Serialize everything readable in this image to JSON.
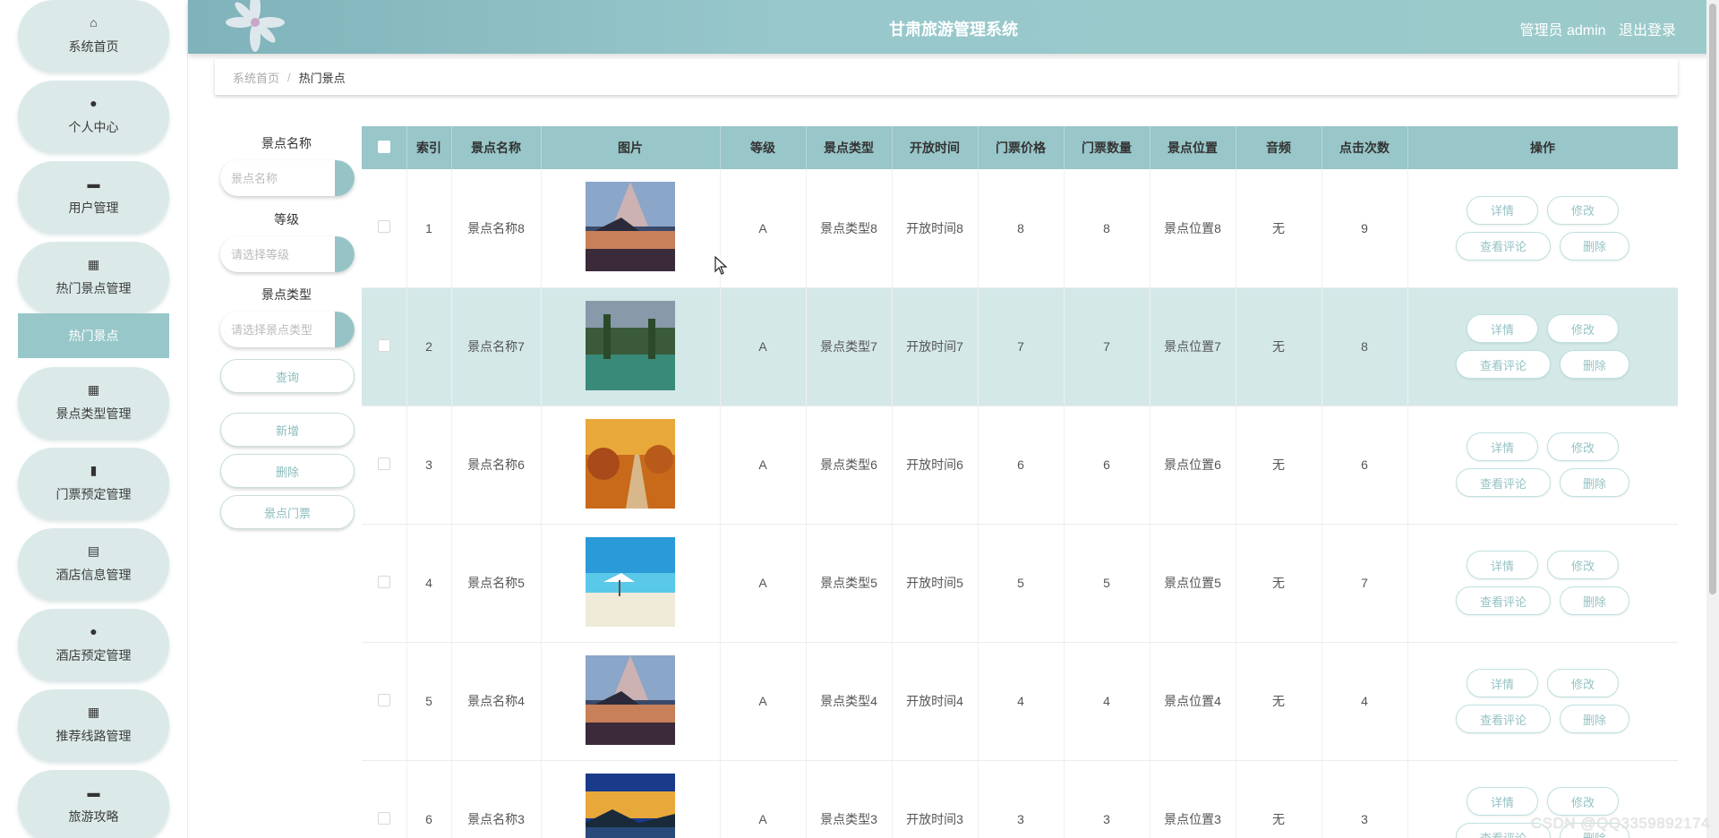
{
  "app": {
    "title": "甘肃旅游管理系统",
    "user_label": "管理员 admin",
    "logout": "退出登录"
  },
  "sidebar": {
    "items": [
      {
        "label": "系统首页",
        "icon": "home-icon",
        "glyph": "⌂"
      },
      {
        "label": "个人中心",
        "icon": "person-icon",
        "glyph": "●"
      },
      {
        "label": "用户管理",
        "icon": "briefcase-icon",
        "glyph": "▬"
      },
      {
        "label": "热门景点管理",
        "icon": "grid-icon",
        "glyph": "▦"
      },
      {
        "label": "景点类型管理",
        "icon": "grid-icon",
        "glyph": "▦"
      },
      {
        "label": "门票预定管理",
        "icon": "bar-chart-icon",
        "glyph": "▮"
      },
      {
        "label": "酒店信息管理",
        "icon": "clipboard-icon",
        "glyph": "▤"
      },
      {
        "label": "酒店预定管理",
        "icon": "bulb-icon",
        "glyph": "●"
      },
      {
        "label": "推荐线路管理",
        "icon": "grid-icon",
        "glyph": "▦"
      },
      {
        "label": "旅游攻略",
        "icon": "monitor-icon",
        "glyph": "▬"
      }
    ],
    "sub_item": "热门景点"
  },
  "breadcrumb": {
    "home": "系统首页",
    "sep": "/",
    "current": "热门景点"
  },
  "filter": {
    "name_label": "景点名称",
    "name_placeholder": "景点名称",
    "level_label": "等级",
    "level_placeholder": "请选择等级",
    "type_label": "景点类型",
    "type_placeholder": "请选择景点类型",
    "query": "查询",
    "add": "新增",
    "delete": "删除",
    "tickets": "景点门票"
  },
  "table": {
    "headers": [
      "索引",
      "景点名称",
      "图片",
      "等级",
      "景点类型",
      "开放时间",
      "门票价格",
      "门票数量",
      "景点位置",
      "音频",
      "点击次数",
      "操作"
    ],
    "rows": [
      {
        "idx": "1",
        "name": "景点名称8",
        "level": "A",
        "type": "景点类型8",
        "open": "开放时间8",
        "price": "8",
        "qty": "8",
        "loc": "景点位置8",
        "audio": "无",
        "clicks": "9"
      },
      {
        "idx": "2",
        "name": "景点名称7",
        "level": "A",
        "type": "景点类型7",
        "open": "开放时间7",
        "price": "7",
        "qty": "7",
        "loc": "景点位置7",
        "audio": "无",
        "clicks": "8"
      },
      {
        "idx": "3",
        "name": "景点名称6",
        "level": "A",
        "type": "景点类型6",
        "open": "开放时间6",
        "price": "6",
        "qty": "6",
        "loc": "景点位置6",
        "audio": "无",
        "clicks": "6"
      },
      {
        "idx": "4",
        "name": "景点名称5",
        "level": "A",
        "type": "景点类型5",
        "open": "开放时间5",
        "price": "5",
        "qty": "5",
        "loc": "景点位置5",
        "audio": "无",
        "clicks": "7"
      },
      {
        "idx": "5",
        "name": "景点名称4",
        "level": "A",
        "type": "景点类型4",
        "open": "开放时间4",
        "price": "4",
        "qty": "4",
        "loc": "景点位置4",
        "audio": "无",
        "clicks": "4"
      },
      {
        "idx": "6",
        "name": "景点名称3",
        "level": "A",
        "type": "景点类型3",
        "open": "开放时间3",
        "price": "3",
        "qty": "3",
        "loc": "景点位置3",
        "audio": "无",
        "clicks": "3"
      }
    ],
    "actions": {
      "detail": "详情",
      "edit": "修改",
      "comments": "查看评论",
      "delete": "删除"
    }
  },
  "watermark": "CSDN @QQ3359892174",
  "colors": {
    "header": "#98c6c9",
    "accent": "#96c4c6",
    "nav_bg": "#dbe9e9"
  }
}
